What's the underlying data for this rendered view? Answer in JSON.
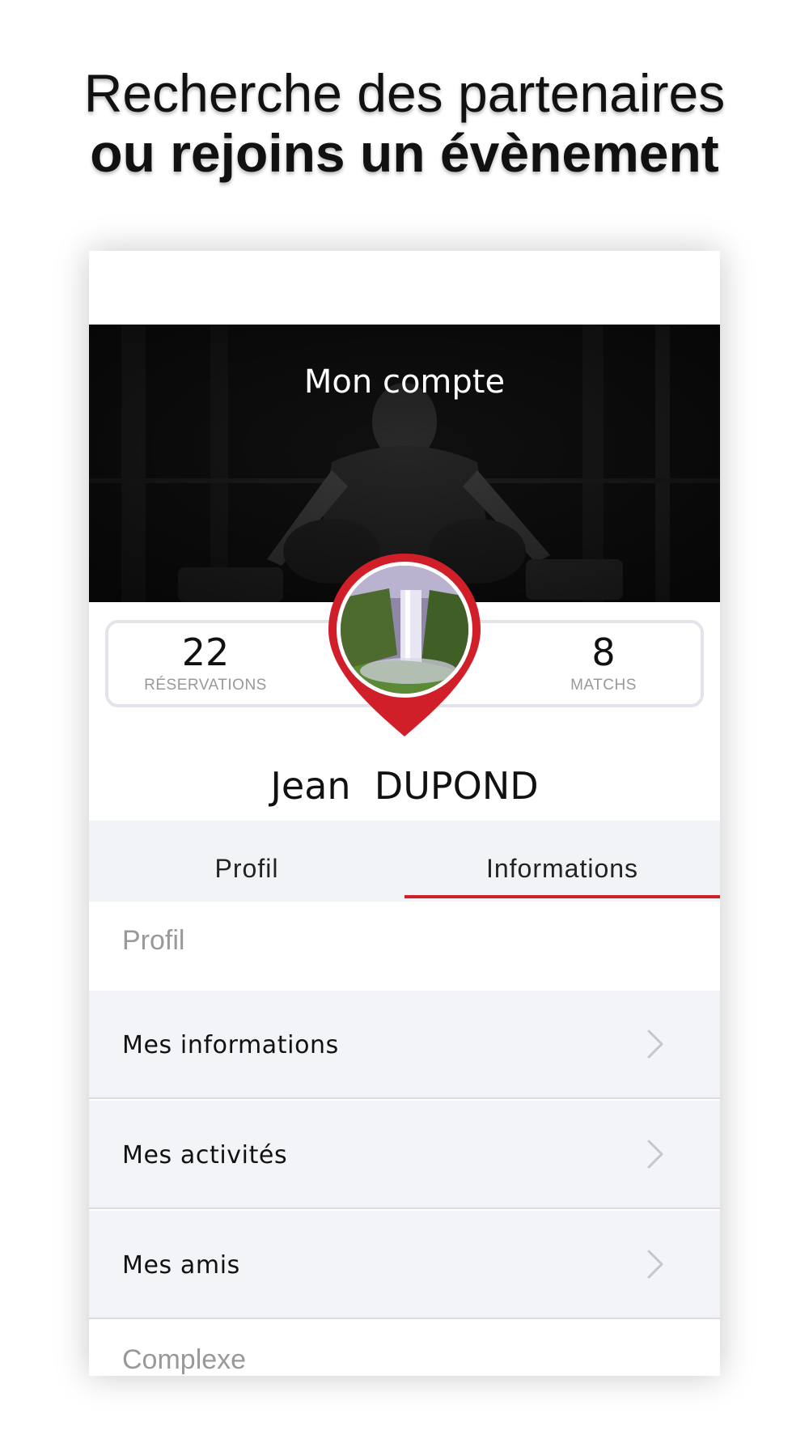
{
  "promo": {
    "line1": "Recherche des partenaires",
    "line2": "ou rejoins un évènement"
  },
  "header": {
    "title": "Mon compte"
  },
  "stats": {
    "reservations": {
      "value": "22",
      "label": "RÉSERVATIONS"
    },
    "matchs": {
      "value": "8",
      "label": "MATCHS"
    }
  },
  "user": {
    "name": "Jean  DUPOND"
  },
  "tabs": [
    {
      "label": "Profil",
      "active": false
    },
    {
      "label": "Informations",
      "active": true
    }
  ],
  "sections": {
    "profil": "Profil",
    "complexe": "Complexe"
  },
  "menu": [
    {
      "label": "Mes informations",
      "icon": "chevron-right-icon"
    },
    {
      "label": "Mes activités",
      "icon": "chevron-right-icon"
    },
    {
      "label": "Mes amis",
      "icon": "chevron-right-icon"
    }
  ],
  "colors": {
    "accent": "#d01f29",
    "tab_background": "#f2f3f7",
    "row_background": "#f3f4f8",
    "muted_text": "#999999"
  }
}
